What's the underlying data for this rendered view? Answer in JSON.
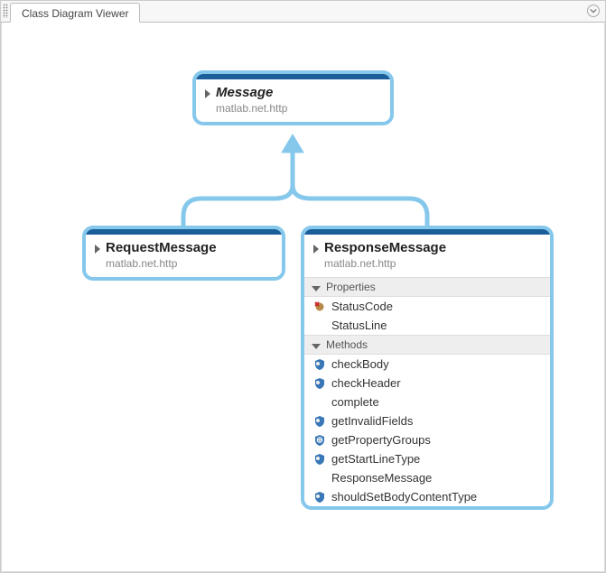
{
  "tab": {
    "title": "Class Diagram Viewer"
  },
  "nodes": {
    "message": {
      "title": "Message",
      "package": "matlab.net.http"
    },
    "request": {
      "title": "RequestMessage",
      "package": "matlab.net.http"
    },
    "response": {
      "title": "ResponseMessage",
      "package": "matlab.net.http",
      "sections": {
        "properties": {
          "label": "Properties",
          "items": [
            {
              "name": "StatusCode",
              "icon": "prop-nonpublic"
            },
            {
              "name": "StatusLine",
              "icon": "none"
            }
          ]
        },
        "methods": {
          "label": "Methods",
          "items": [
            {
              "name": "checkBody",
              "icon": "method-shield"
            },
            {
              "name": "checkHeader",
              "icon": "method-shield"
            },
            {
              "name": "complete",
              "icon": "none"
            },
            {
              "name": "getInvalidFields",
              "icon": "method-shield"
            },
            {
              "name": "getPropertyGroups",
              "icon": "method-globe"
            },
            {
              "name": "getStartLineType",
              "icon": "method-shield"
            },
            {
              "name": "ResponseMessage",
              "icon": "none"
            },
            {
              "name": "shouldSetBodyContentType",
              "icon": "method-shield"
            }
          ]
        }
      }
    }
  }
}
